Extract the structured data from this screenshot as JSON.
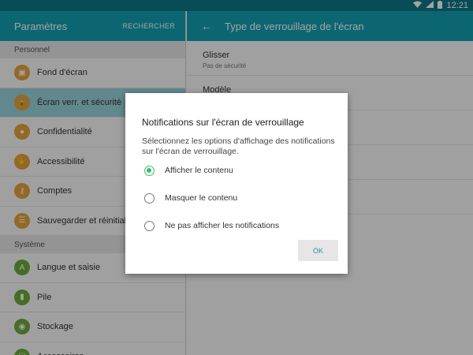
{
  "statusbar": {
    "time": "12:21",
    "wifi_icon": "wifi-icon",
    "signal_icon": "signal-icon",
    "battery_icon": "battery-icon"
  },
  "left": {
    "title": "Paramètres",
    "search_label": "RECHERCHER",
    "sections": [
      {
        "header": "Personnel",
        "items": [
          {
            "label": "Fond d'écran",
            "icon": "wallpaper-icon",
            "glyph": "▣",
            "selected": false
          },
          {
            "label": "Écran verr. et sécurité",
            "icon": "lock-icon",
            "glyph": "🔒",
            "selected": true
          },
          {
            "label": "Confidentialité",
            "icon": "privacy-icon",
            "glyph": "●",
            "selected": false
          },
          {
            "label": "Accessibilité",
            "icon": "hand-icon",
            "glyph": "✋",
            "selected": false
          },
          {
            "label": "Comptes",
            "icon": "key-icon",
            "glyph": "⚷",
            "selected": false
          },
          {
            "label": "Sauvegarder et réinitialis",
            "icon": "backup-icon",
            "glyph": "☰",
            "selected": false
          }
        ]
      },
      {
        "header": "Système",
        "items": [
          {
            "label": "Langue et saisie",
            "icon": "language-icon",
            "glyph": "A",
            "selected": false
          },
          {
            "label": "Pile",
            "icon": "battery-icon",
            "glyph": "▮",
            "selected": false
          },
          {
            "label": "Stockage",
            "icon": "storage-icon",
            "glyph": "◉",
            "selected": false
          },
          {
            "label": "Accessoires",
            "icon": "accessories-icon",
            "glyph": "▢",
            "selected": false
          }
        ]
      }
    ]
  },
  "right": {
    "back_icon": "back-arrow-icon",
    "title": "Type de verrouillage de l'écran",
    "options": [
      {
        "title": "Glisser",
        "subtitle": "Pas de sécurité"
      },
      {
        "title": "Modèle",
        "subtitle": ""
      }
    ]
  },
  "dialog": {
    "title": "Notifications sur l'écran de verrouillage",
    "description": "Sélectionnez les options d'affichage des notifications sur l'écran de verrouillage.",
    "options": [
      {
        "label": "Afficher le contenu",
        "selected": true
      },
      {
        "label": "Masquer le contenu",
        "selected": false
      },
      {
        "label": "Ne pas afficher les notifications",
        "selected": false
      }
    ],
    "ok_label": "OK",
    "accent_color": "#3ebb6c"
  },
  "colors": {
    "header": "#14a0b2",
    "statusbar": "#0d7787",
    "selected_row": "#9ad3dc"
  }
}
